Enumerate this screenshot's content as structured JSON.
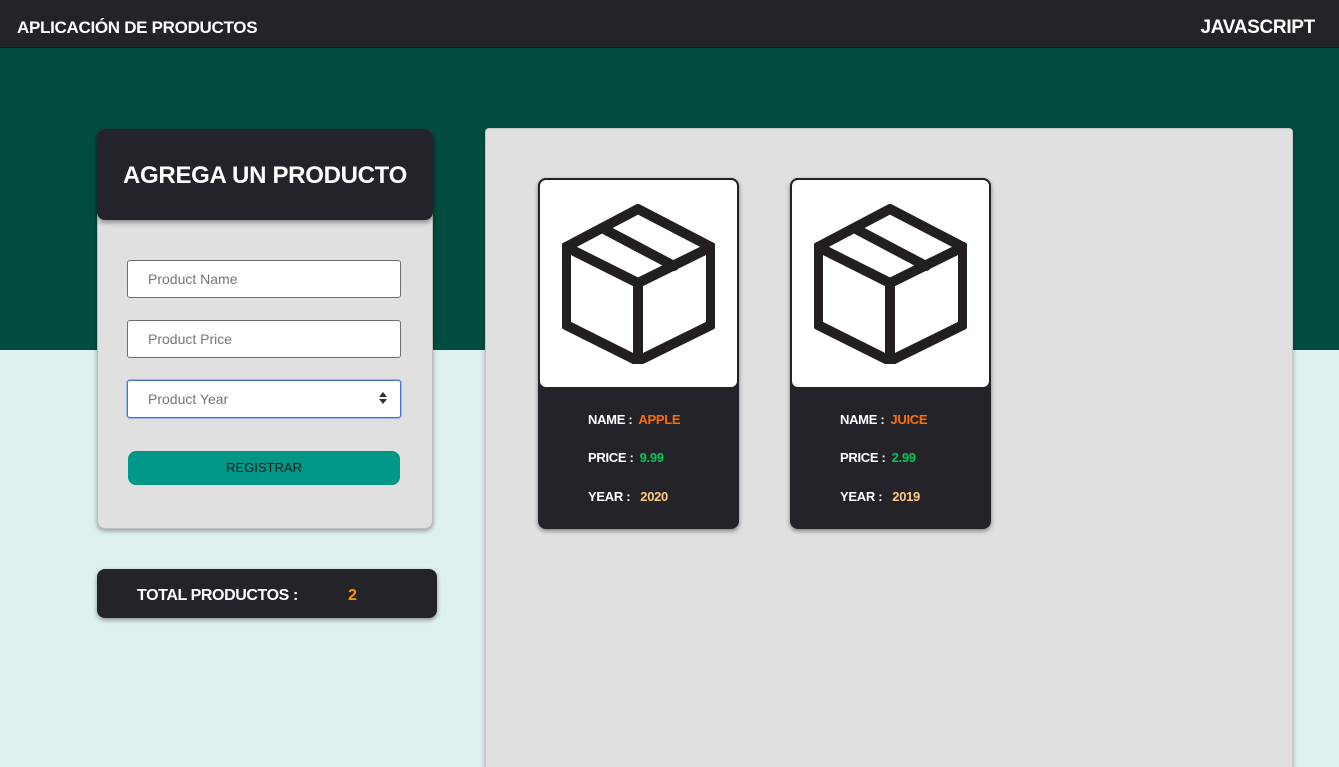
{
  "header": {
    "brand": "APLICACIÓN DE PRODUCTOS",
    "tech": "JAVASCRIPT"
  },
  "form": {
    "title": "AGREGA UN PRODUCTO",
    "name_placeholder": "Product Name",
    "price_placeholder": "Product Price",
    "year_placeholder": "Product Year",
    "submit_label": "REGISTRAR"
  },
  "total": {
    "label": "TOTAL PRODUCTOS :",
    "count": "2"
  },
  "product_labels": {
    "name": "NAME :",
    "price": "PRICE :",
    "year": "YEAR :"
  },
  "products": [
    {
      "icon": "box-icon",
      "name": "APPLE",
      "price": "9.99",
      "year": "2020"
    },
    {
      "icon": "box-icon",
      "name": "JUICE",
      "price": "2.99",
      "year": "2019"
    }
  ],
  "colors": {
    "topbar": "#25232a",
    "hero": "#004d40",
    "page_bg": "#dff0f0",
    "button": "#009688",
    "total_count": "#ff9800",
    "name_value": "#ff6d00",
    "price_value": "#00c853",
    "year_value": "#ffcc80"
  }
}
